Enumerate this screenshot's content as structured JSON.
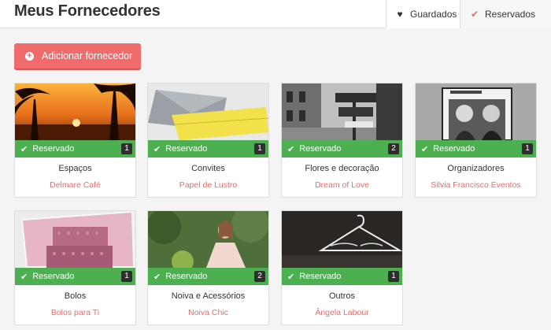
{
  "header": {
    "title": "Meus Fornecedores",
    "tabs": [
      {
        "label": "Guardados",
        "icon": "heart-icon"
      },
      {
        "label": "Reservados",
        "icon": "check-icon"
      }
    ]
  },
  "actions": {
    "add_label": "Adicionar fornecedor",
    "add_icon": "plus-circle-icon"
  },
  "colors": {
    "accent": "#f06b6b",
    "reserved": "#4caf50",
    "vendor_link": "#e86b6b"
  },
  "cards": [
    {
      "status": "Reservado",
      "count": "1",
      "category": "Espaços",
      "vendor": "Delmare Café"
    },
    {
      "status": "Reservado",
      "count": "1",
      "category": "Convites",
      "vendor": "Papel de Lustro"
    },
    {
      "status": "Reservado",
      "count": "2",
      "category": "Flores e decoração",
      "vendor": "Dream of Love"
    },
    {
      "status": "Reservado",
      "count": "1",
      "category": "Organizadores",
      "vendor": "Silvia Francisco Eventos"
    },
    {
      "status": "Reservado",
      "count": "1",
      "category": "Bolos",
      "vendor": "Bolos para Ti"
    },
    {
      "status": "Reservado",
      "count": "2",
      "category": "Noiva e Acessórios",
      "vendor": "Noiva Chic"
    },
    {
      "status": "Reservado",
      "count": "1",
      "category": "Outros",
      "vendor": "Ângela Labour"
    }
  ]
}
